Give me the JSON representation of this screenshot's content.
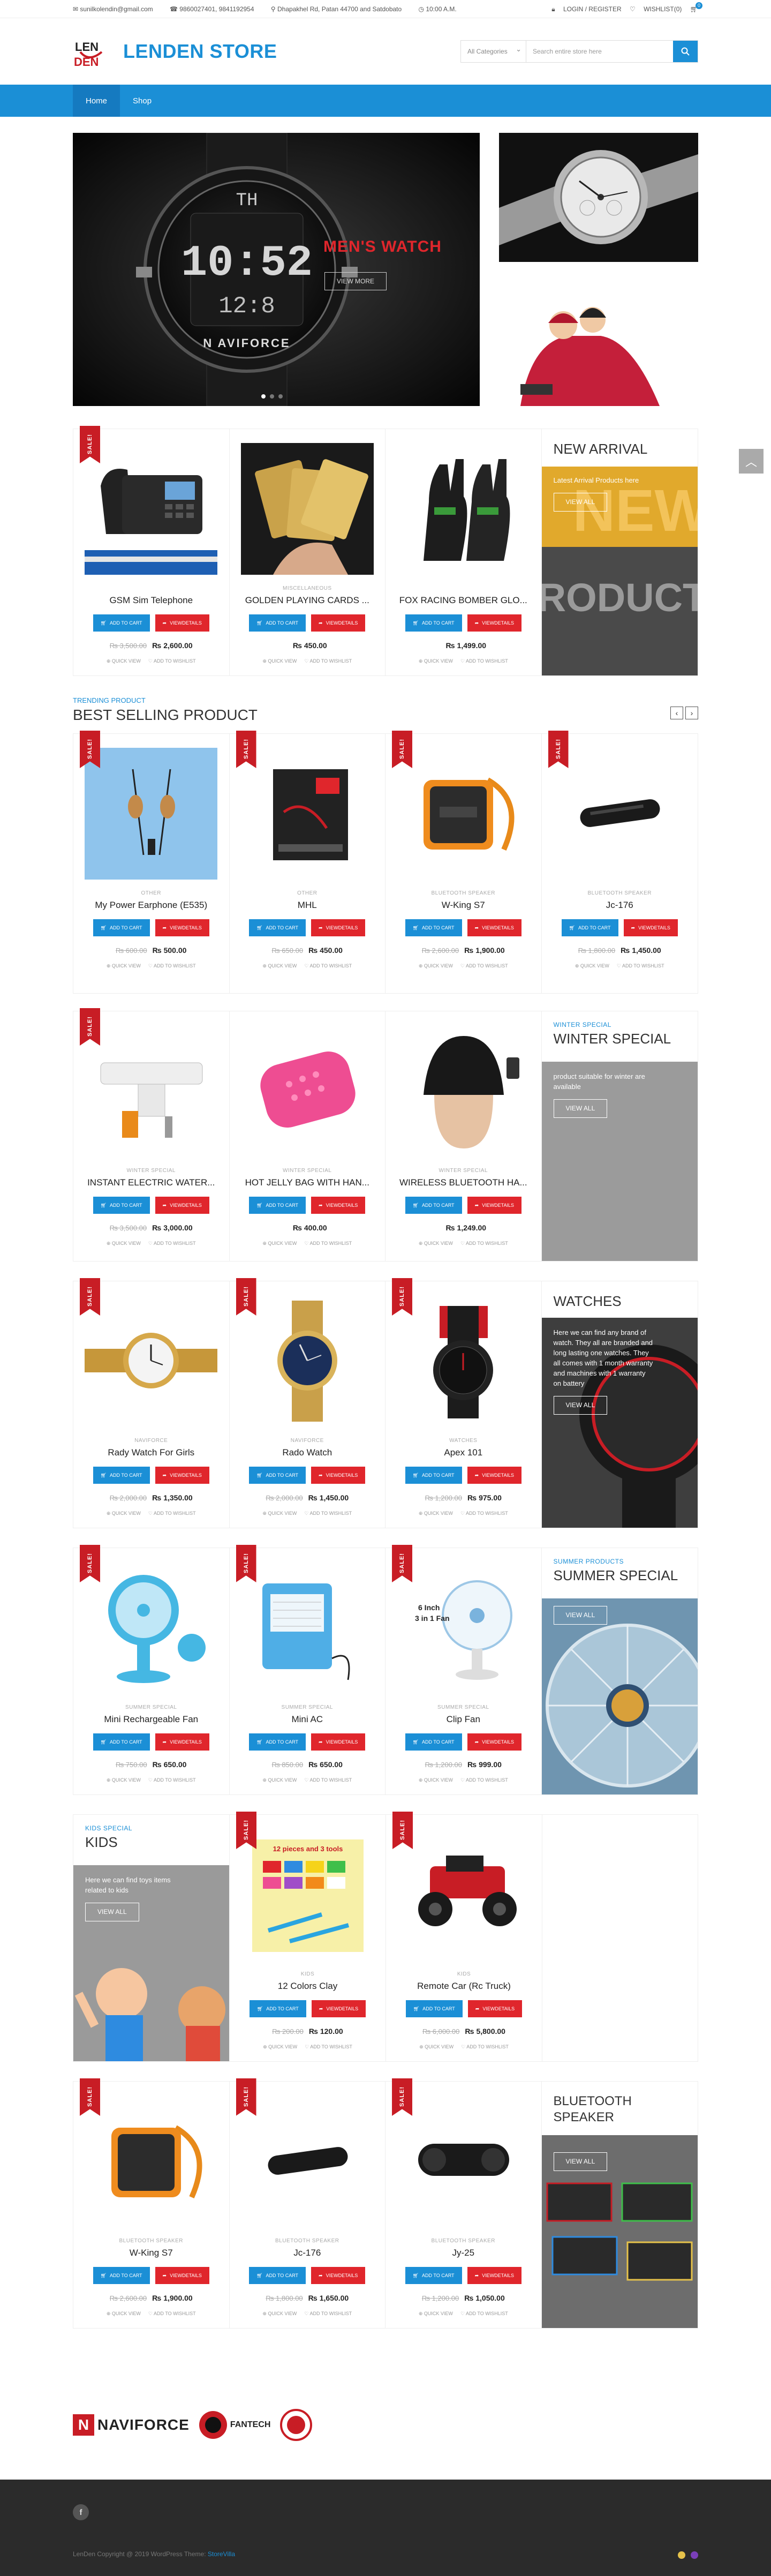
{
  "topbar": {
    "email": "sunilkolendin@gmail.com",
    "phone": "9860027401, 9841192954",
    "address": "Dhapakhel Rd, Patan 44700 and Satdobato",
    "hours": "10:00 A.M.",
    "login": "LOGIN / REGISTER",
    "wishlist": "WISHLIST(0)",
    "cart_count": "0"
  },
  "header": {
    "logo_top": "LEN",
    "logo_bottom": "DEN",
    "site_name": "LENDEN STORE",
    "search_category": "All Categories",
    "search_placeholder": "Search entire store here"
  },
  "nav": [
    "Home",
    "Shop"
  ],
  "slider": {
    "title": "MEN'S WATCH",
    "button": "VIEW MORE",
    "brand": "N AVIFORCE",
    "digits_top": "TH",
    "digits_mid": "10:52",
    "digits_bot": "12:8"
  },
  "labels": {
    "sale": "SALE!",
    "add_to_cart": "ADD TO CART",
    "view_details": "VIEWDETAILS",
    "quick_view": "QUICK VIEW",
    "add_to_wishlist": "ADD TO WISHLIST",
    "view_all": "VIEW ALL"
  },
  "new_arrival": {
    "title": "NEW ARRIVAL",
    "text": "Latest Arrival Products here",
    "bg_word1": "NEW",
    "bg_word2": "PRODUCTS"
  },
  "row1": [
    {
      "cat": "",
      "name": "GSM Sim Telephone",
      "old": "₨ 3,500.00",
      "new": "₨ 2,600.00"
    },
    {
      "cat": "MISCELLANEOUS",
      "name": "GOLDEN PLAYING CARDS ...",
      "old": "",
      "new": "₨ 450.00"
    },
    {
      "cat": "",
      "name": "FOX RACING BOMBER GLO...",
      "old": "",
      "new": "₨ 1,499.00"
    }
  ],
  "best": {
    "sub": "TRENDING PRODUCT",
    "title": "BEST SELLING PRODUCT",
    "items": [
      {
        "cat": "OTHER",
        "name": "My Power Earphone (E535)",
        "old": "₨ 600.00",
        "new": "₨ 500.00"
      },
      {
        "cat": "OTHER",
        "name": "MHL",
        "old": "₨ 650.00",
        "new": "₨ 450.00"
      },
      {
        "cat": "BLUETOOTH SPEAKER",
        "name": "W-King S7",
        "old": "₨ 2,600.00",
        "new": "₨ 1,900.00"
      },
      {
        "cat": "BLUETOOTH SPEAKER",
        "name": "Jc-176",
        "old": "₨ 1,800.00",
        "new": "₨ 1,450.00"
      }
    ]
  },
  "winter": {
    "sub": "WINTER SPECIAL",
    "title": "WINTER SPECIAL",
    "text": "product suitable for winter are available",
    "items": [
      {
        "cat": "WINTER SPECIAL",
        "name": "INSTANT ELECTRIC WATER...",
        "old": "₨ 3,500.00",
        "new": "₨ 3,000.00"
      },
      {
        "cat": "WINTER SPECIAL",
        "name": "HOT JELLY BAG WITH HAN...",
        "old": "",
        "new": "₨ 400.00"
      },
      {
        "cat": "WINTER SPECIAL",
        "name": "WIRELESS BLUETOOTH HA...",
        "old": "",
        "new": "₨ 1,249.00"
      }
    ]
  },
  "watches": {
    "title": "WATCHES",
    "text": "Here we can find any brand of watch. They all are branded and long lasting one watches. They all comes with 1 month warranty and machines with 1 warranty on battery",
    "items": [
      {
        "cat": "NAVIFORCE",
        "name": "Rady Watch For Girls",
        "old": "₨ 2,000.00",
        "new": "₨ 1,350.00"
      },
      {
        "cat": "NAVIFORCE",
        "name": "Rado Watch",
        "old": "₨ 2,000.00",
        "new": "₨ 1,450.00"
      },
      {
        "cat": "WATCHES",
        "name": "Apex 101",
        "old": "₨ 1,200.00",
        "new": "₨ 975.00"
      }
    ]
  },
  "summer": {
    "sub": "SUMMER PRODUCTS",
    "title": "SUMMER SPECIAL",
    "items": [
      {
        "cat": "SUMMER SPECIAL",
        "name": "Mini Rechargeable Fan",
        "old": "₨ 750.00",
        "new": "₨ 650.00"
      },
      {
        "cat": "SUMMER SPECIAL",
        "name": "Mini AC",
        "old": "₨ 850.00",
        "new": "₨ 650.00"
      },
      {
        "cat": "SUMMER SPECIAL",
        "name": "Clip Fan",
        "old": "₨ 1,200.00",
        "new": "₨ 999.00"
      }
    ],
    "fan_label": "6 Inch\n3 in 1 Fan"
  },
  "kids": {
    "sub": "KIDS SPECIAL",
    "title": "KIDS",
    "text": "Here we can find toys items related to kids",
    "items": [
      {
        "cat": "KIDS",
        "name": "12 Colors Clay",
        "old": "₨ 200.00",
        "new": "₨ 120.00"
      },
      {
        "cat": "KIDS",
        "name": "Remote Car (Rc Truck)",
        "old": "₨ 6,000.00",
        "new": "₨ 5,800.00"
      }
    ],
    "clay_label": "12 pieces and 3 tools"
  },
  "bluetooth": {
    "title": "BLUETOOTH SPEAKER",
    "items": [
      {
        "cat": "BLUETOOTH SPEAKER",
        "name": "W-King S7",
        "old": "₨ 2,600.00",
        "new": "₨ 1,900.00"
      },
      {
        "cat": "BLUETOOTH SPEAKER",
        "name": "Jc-176",
        "old": "₨ 1,800.00",
        "new": "₨ 1,650.00"
      },
      {
        "cat": "BLUETOOTH SPEAKER",
        "name": "Jy-25",
        "old": "₨ 1,200.00",
        "new": "₨ 1,050.00"
      }
    ]
  },
  "brands": [
    "NAVIFORCE",
    "FANTECH"
  ],
  "footer": {
    "copyright_pre": "LenDen Copyright @ 2019 WordPress Theme: ",
    "copyright_link": "StoreVilla"
  },
  "colors": {
    "primary": "#1b8fd6",
    "sale": "#c81d25",
    "view": "#e0262c"
  }
}
